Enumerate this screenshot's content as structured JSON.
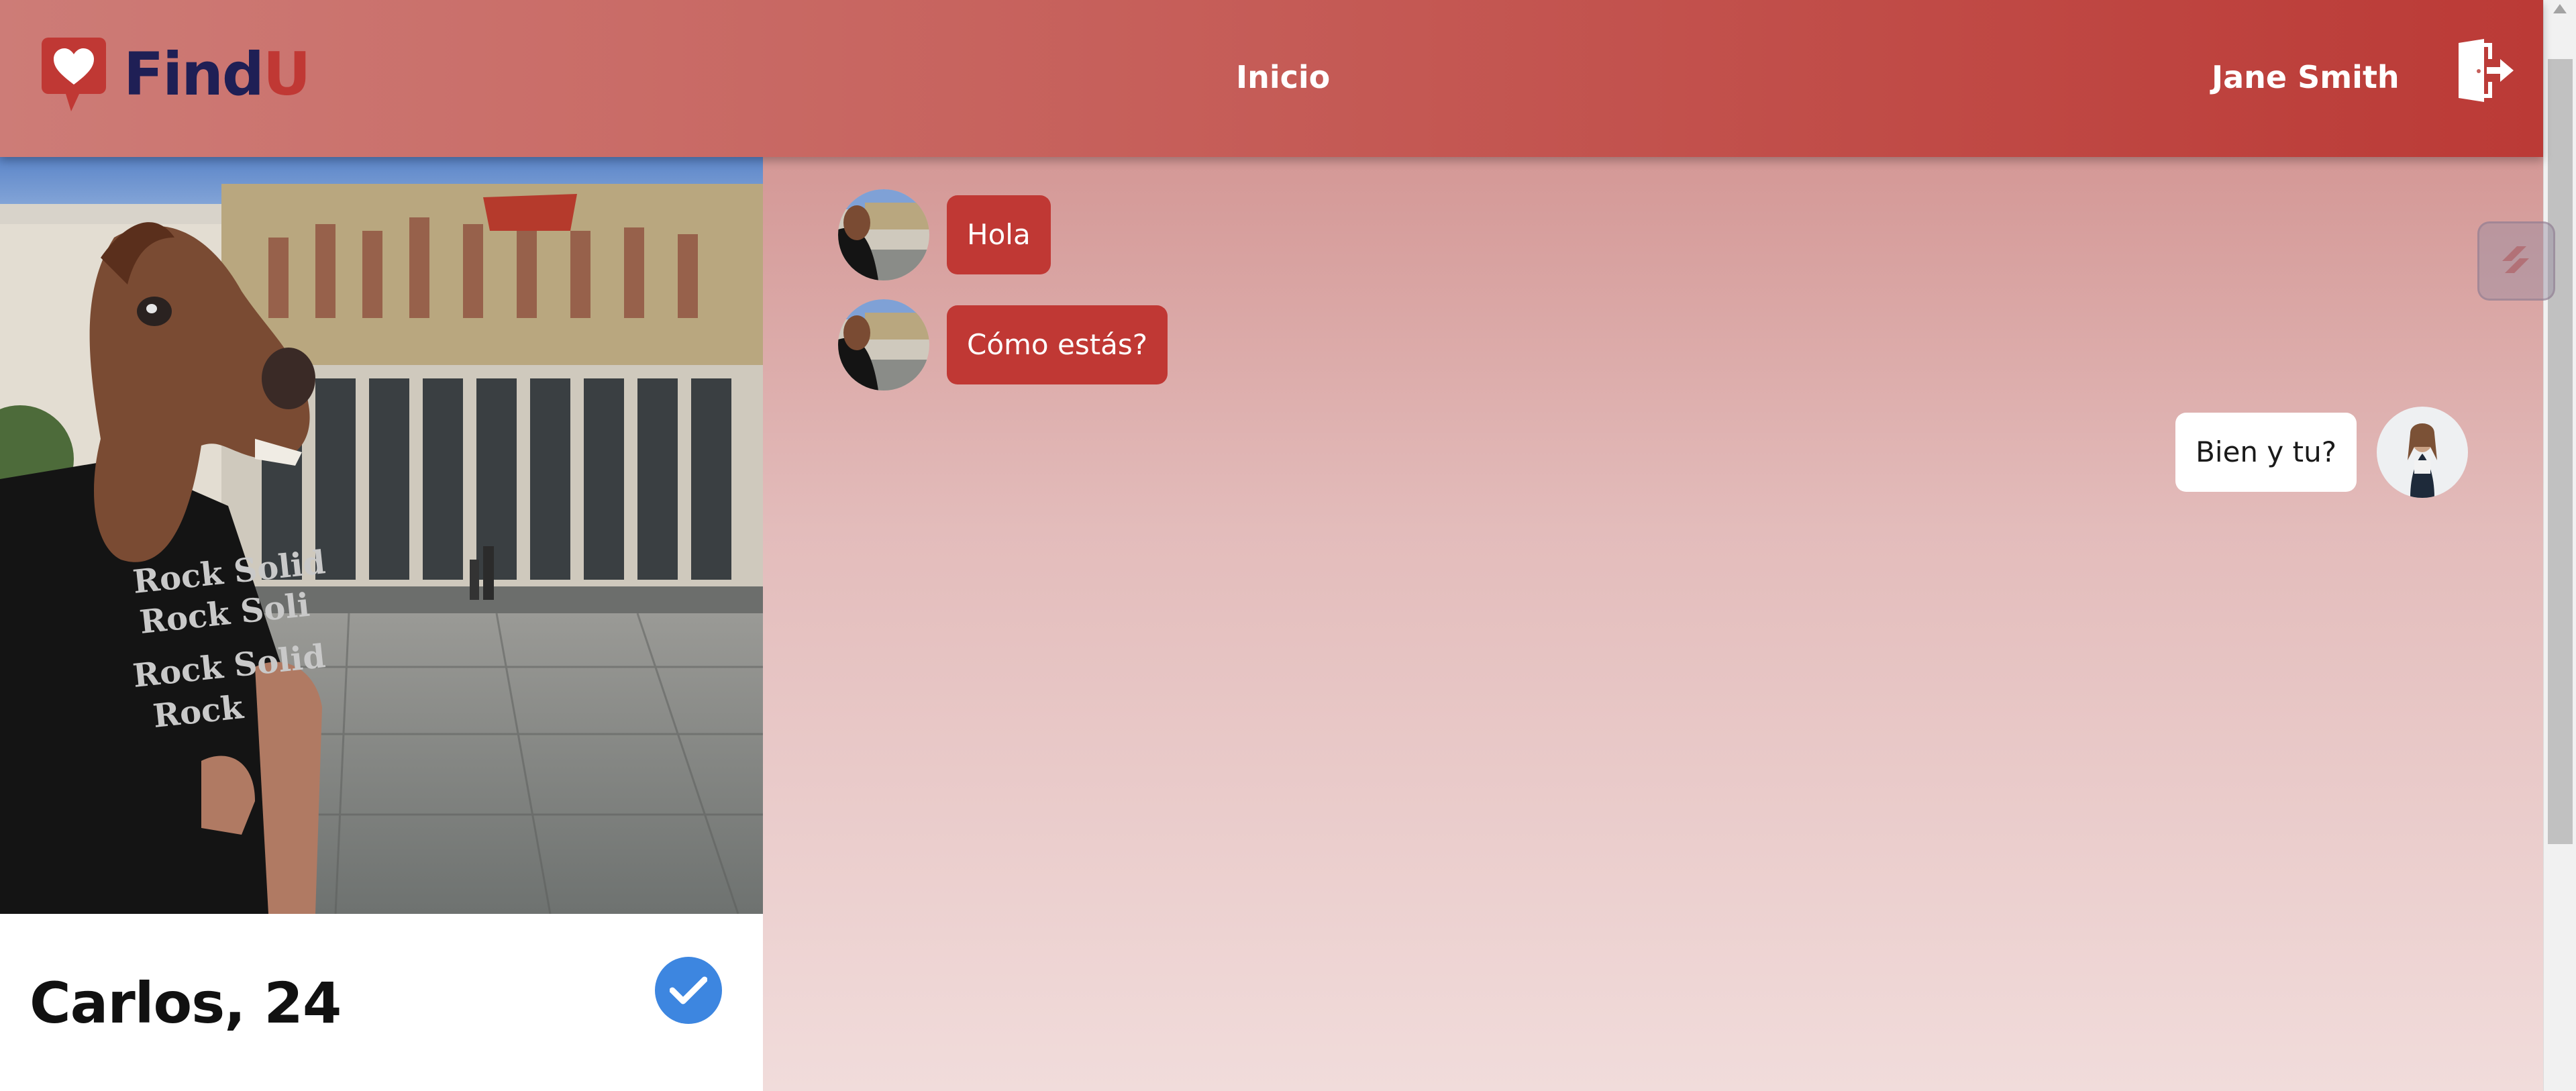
{
  "header": {
    "logo": {
      "find": "Find",
      "u": "U"
    },
    "nav_home": "Inicio",
    "user_name": "Jane Smith"
  },
  "profile": {
    "name_age": "Carlos, 24",
    "verified": true
  },
  "chat": {
    "messages": [
      {
        "text": "Hola",
        "from": "match"
      },
      {
        "text": "Cómo estás?",
        "from": "match"
      },
      {
        "text": "Bien y tu?",
        "from": "me"
      }
    ]
  },
  "colors": {
    "brand_red": "#c03834",
    "brand_navy": "#1f1f55",
    "verified_blue": "#3d86e0"
  },
  "icons": [
    "heart-chat-icon",
    "logout-door-icon",
    "checkmark-icon",
    "side-widget-icon"
  ]
}
